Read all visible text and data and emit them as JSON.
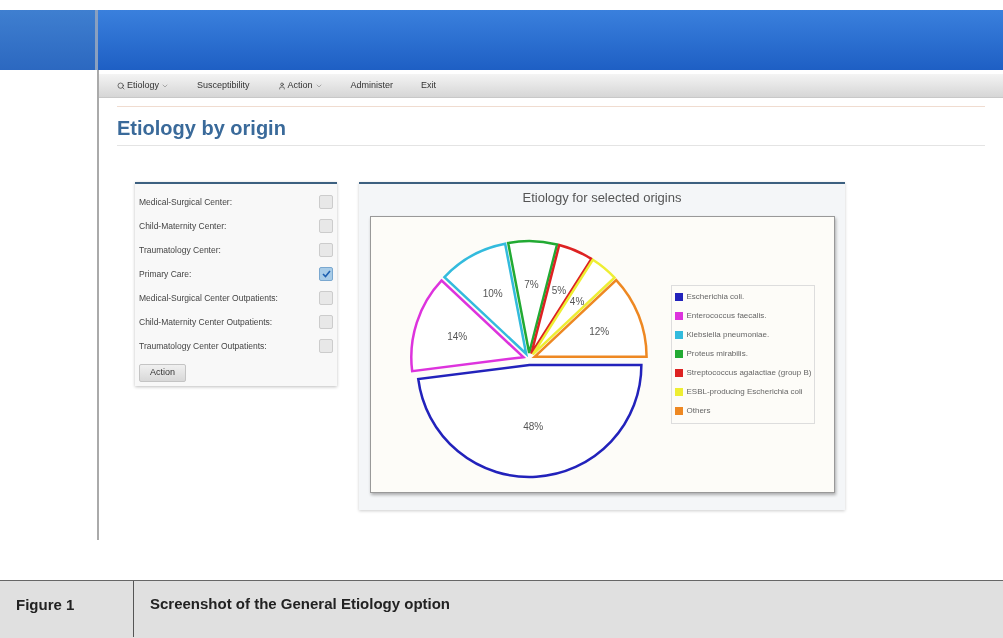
{
  "menu": [
    {
      "label": "Etiology",
      "kind": "search",
      "dropdown": true
    },
    {
      "label": "Susceptibility",
      "kind": "plain",
      "dropdown": false
    },
    {
      "label": "Action",
      "kind": "person",
      "dropdown": true
    },
    {
      "label": "Administer",
      "kind": "plain",
      "dropdown": false
    },
    {
      "label": "Exit",
      "kind": "plain",
      "dropdown": false
    }
  ],
  "page_title": "Etiology by origin",
  "origins": [
    {
      "label": "Medical-Surgical Center:",
      "checked": false
    },
    {
      "label": "Child-Maternity Center:",
      "checked": false
    },
    {
      "label": "Traumatology Center:",
      "checked": false
    },
    {
      "label": "Primary Care:",
      "checked": true
    },
    {
      "label": "Medical-Surgical Center Outpatients:",
      "checked": false
    },
    {
      "label": "Child-Maternity Center Outpatients:",
      "checked": false
    },
    {
      "label": "Traumatology Center Outpatients:",
      "checked": false
    }
  ],
  "action_button": "Action",
  "chart": {
    "chart_data": {
      "type": "pie",
      "title": "Etiology for selected origins",
      "categories": [
        "Escherichia coli.",
        "Enterococcus faecalis.",
        "Klebsiella pneumoniae.",
        "Proteus mirabilis.",
        "Streptococcus agalactiae (group B)",
        "ESBL-producing Escherichia coli",
        "Others"
      ],
      "values": [
        48,
        14,
        10,
        7,
        5,
        4,
        12
      ],
      "colors": [
        "#2222bb",
        "#dd33dd",
        "#33bbdd",
        "#22aa33",
        "#dd2222",
        "#eeee33",
        "#ee8822"
      ],
      "value_labels": [
        "48%",
        "14%",
        "10%",
        "7%",
        "5%",
        "4%",
        "12%"
      ]
    }
  },
  "caption": {
    "label": "Figure 1",
    "text": "Screenshot of the General Etiology option"
  }
}
